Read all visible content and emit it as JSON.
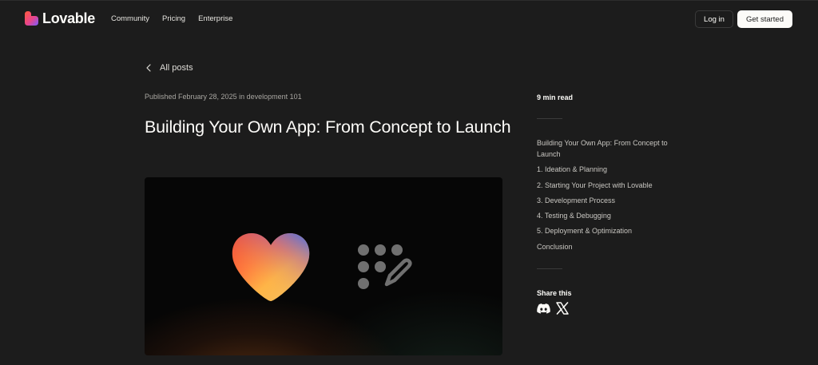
{
  "header": {
    "brand": "Lovable",
    "nav": [
      "Community",
      "Pricing",
      "Enterprise"
    ],
    "login_label": "Log in",
    "get_started_label": "Get started"
  },
  "article": {
    "back_label": "All posts",
    "published": "Published February 28, 2025 in development 101",
    "title": "Building Your Own App: From Concept to Launch"
  },
  "sidebar": {
    "read_time": "9 min read",
    "toc": [
      "Building Your Own App: From Concept to Launch",
      "1. Ideation & Planning",
      "2. Starting Your Project with Lovable",
      "3. Development Process",
      "4. Testing & Debugging",
      "5. Deployment & Optimization",
      "Conclusion"
    ],
    "share_label": "Share this",
    "share_icons": [
      "discord-icon",
      "x-icon"
    ]
  },
  "colors": {
    "background": "#1c1c1c",
    "text": "#fcfbf8",
    "muted": "#a8a6a1",
    "button_light": "#fcfbf8"
  }
}
